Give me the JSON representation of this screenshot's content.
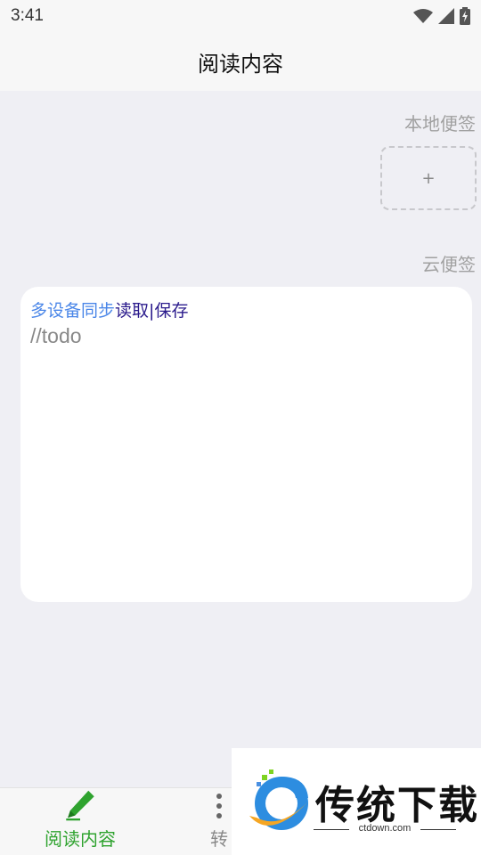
{
  "status_bar": {
    "time": "3:41"
  },
  "app_bar": {
    "title": "阅读内容"
  },
  "local_notes": {
    "label": "本地便签",
    "add_symbol": "+"
  },
  "cloud_notes": {
    "label": "云便签",
    "sync_text": "多设备同步",
    "read_label": "读取",
    "separator": "|",
    "save_label": "保存",
    "content": "//todo"
  },
  "bottom_nav": {
    "items": [
      {
        "label": "阅读内容",
        "icon": "pen-icon",
        "active": true
      },
      {
        "label": "转",
        "icon": "more-icon",
        "active": false
      }
    ]
  },
  "watermark": {
    "title": "传统下载",
    "subtitle": "ctdown.com"
  },
  "colors": {
    "accent_green": "#2fa32f",
    "link_blue": "#4a86e8",
    "link_dark": "#2a1a8c",
    "background": "#efeff4"
  }
}
